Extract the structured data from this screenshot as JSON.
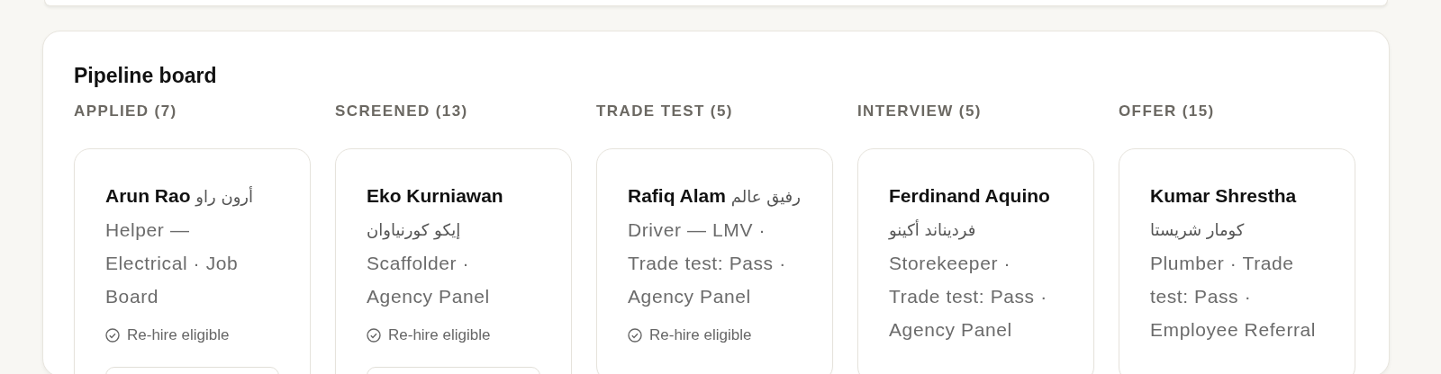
{
  "board": {
    "title": "Pipeline board",
    "columns": [
      {
        "heading": "APPLIED (7)",
        "cards": [
          {
            "name": "Arun Rao",
            "name_ar": "أرون راو",
            "details": "Helper — Electrical · Job Board",
            "badge": "Re-hire eligible",
            "footer_button": true
          }
        ]
      },
      {
        "heading": "SCREENED (13)",
        "cards": [
          {
            "name": "Eko Kurniawan",
            "name_ar": "إيكو كورنياوان",
            "details": "Scaffolder · Agency Panel",
            "badge": "Re-hire eligible",
            "footer_button": true
          }
        ]
      },
      {
        "heading": "TRADE TEST (5)",
        "cards": [
          {
            "name": "Rafiq Alam",
            "name_ar": "رفيق عالم",
            "details": "Driver — LMV · Trade test: Pass · Agency Panel",
            "badge": "Re-hire eligible",
            "footer_button": false
          }
        ]
      },
      {
        "heading": "INTERVIEW (5)",
        "cards": [
          {
            "name": "Ferdinand Aquino",
            "name_ar": "فرديناند أكينو",
            "details": "Storekeeper · Trade test: Pass · Agency Panel",
            "footer_button": false
          }
        ]
      },
      {
        "heading": "OFFER (15)",
        "cards": [
          {
            "name": "Kumar Shrestha",
            "name_ar": "كومار شريستا",
            "details": "Plumber · Trade test: Pass · Employee Referral",
            "footer_button": false
          }
        ]
      }
    ]
  }
}
